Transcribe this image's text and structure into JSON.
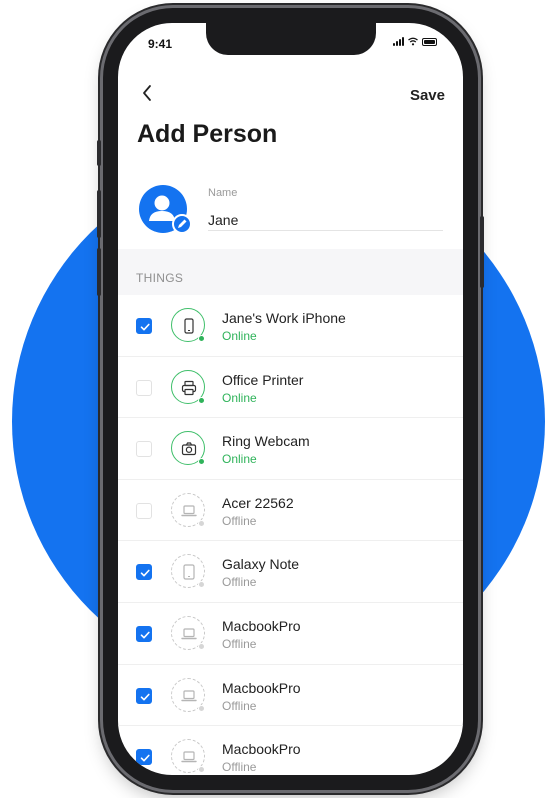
{
  "status_bar": {
    "time": "9:41"
  },
  "header": {
    "save_label": "Save",
    "title": "Add Person"
  },
  "person": {
    "name_label": "Name",
    "name_value": "Jane"
  },
  "section": {
    "title": "THINGS"
  },
  "colors": {
    "accent": "#1473f0",
    "online": "#2fb35a",
    "offline": "#9a9a9a"
  },
  "devices": [
    {
      "name": "Jane's Work iPhone",
      "status": "Online",
      "online": true,
      "checked": true,
      "icon": "phone-icon"
    },
    {
      "name": "Office Printer",
      "status": "Online",
      "online": true,
      "checked": false,
      "icon": "printer-icon"
    },
    {
      "name": "Ring Webcam",
      "status": "Online",
      "online": true,
      "checked": false,
      "icon": "camera-icon"
    },
    {
      "name": "Acer 22562",
      "status": "Offline",
      "online": false,
      "checked": false,
      "icon": "laptop-icon"
    },
    {
      "name": "Galaxy Note",
      "status": "Offline",
      "online": false,
      "checked": true,
      "icon": "tablet-icon"
    },
    {
      "name": "MacbookPro",
      "status": "Offline",
      "online": false,
      "checked": true,
      "icon": "laptop-icon"
    },
    {
      "name": "MacbookPro",
      "status": "Offline",
      "online": false,
      "checked": true,
      "icon": "laptop-icon"
    },
    {
      "name": "MacbookPro",
      "status": "Offline",
      "online": false,
      "checked": true,
      "icon": "laptop-icon"
    }
  ]
}
